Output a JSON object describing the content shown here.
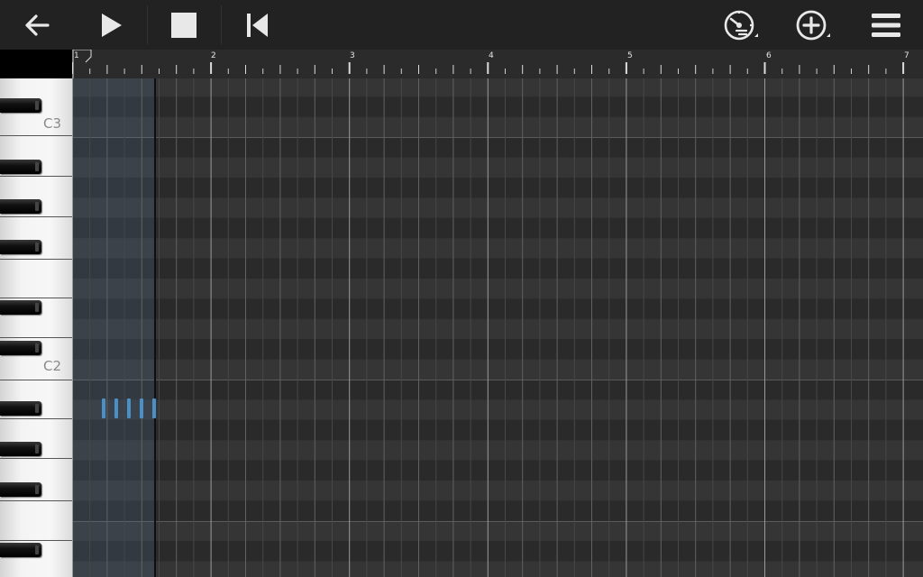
{
  "toolbar": {
    "back_icon": "arrow-left-icon",
    "play_icon": "play-icon",
    "stop_icon": "stop-icon",
    "rewind_icon": "skip-to-start-icon",
    "metronome_icon": "metronome-settings-icon",
    "add_icon": "add-circle-icon",
    "menu_icon": "hamburger-menu-icon"
  },
  "ruler": {
    "bars": [
      "1",
      "2",
      "3",
      "4",
      "5",
      "6",
      "7"
    ]
  },
  "keyboard": {
    "labels": [
      "C3",
      "C2"
    ]
  },
  "notes": [
    {
      "beat_sixteenth": 2
    },
    {
      "beat_sixteenth": 3
    },
    {
      "beat_sixteenth": 4
    },
    {
      "beat_sixteenth": 5
    },
    {
      "beat_sixteenth": 6
    }
  ],
  "colors": {
    "toolbar_bg": "#222222",
    "icon": "#e8e8e8",
    "note": "#4a90c8",
    "selection": "#3a4a5a",
    "row_light": "#353535",
    "row_dark": "#2a2a2a"
  }
}
